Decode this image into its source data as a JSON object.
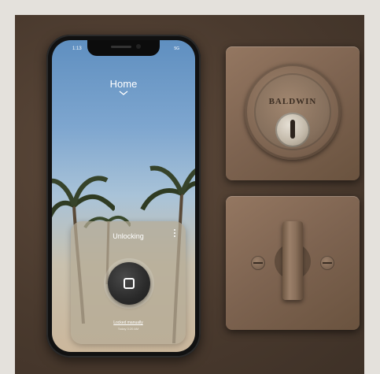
{
  "phone": {
    "status_time": "1:13",
    "status_right": "5G",
    "home_title": "Home"
  },
  "lock_card": {
    "title": "Unlocking",
    "status": "Locked manually",
    "substatus": "Today 3:20 AM"
  },
  "hardware": {
    "deadbolt_brand": "BALDWIN"
  },
  "colors": {
    "bronze": "#7d6350",
    "backdrop": "#4a3a2e"
  }
}
